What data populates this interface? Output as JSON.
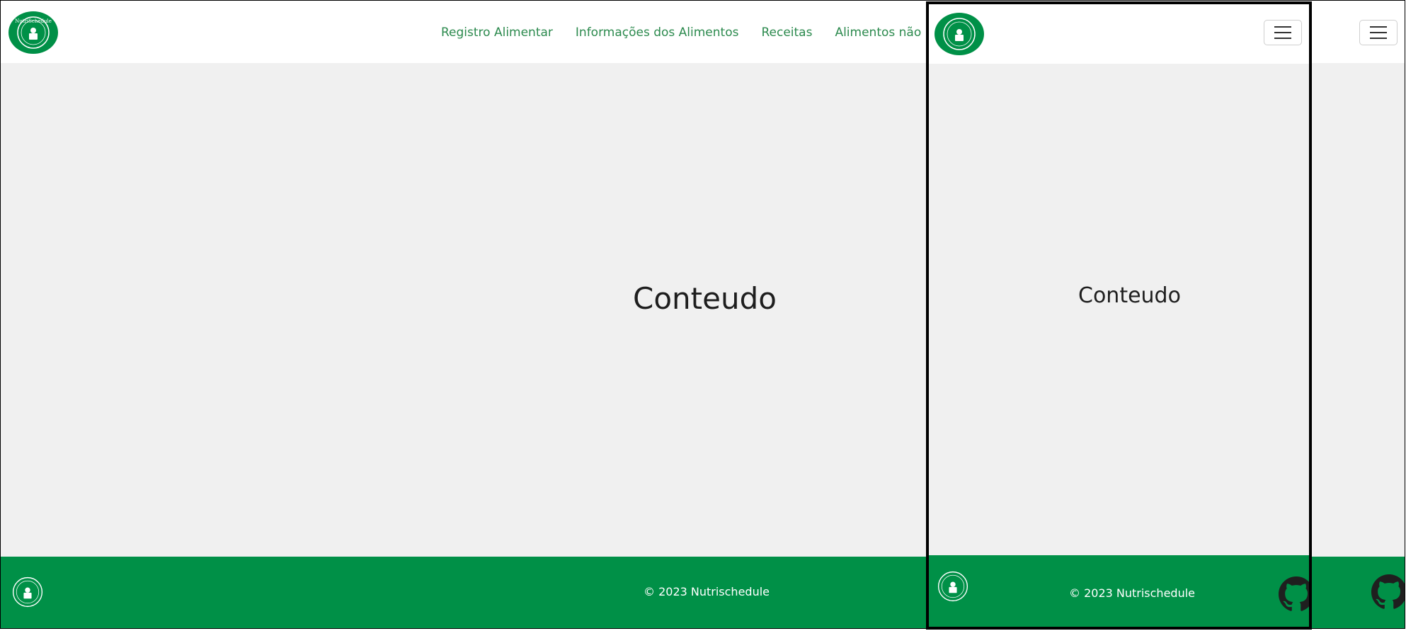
{
  "desktop": {
    "logo_alt": "NutriSchedule",
    "nav": {
      "links": [
        {
          "label": "Registro Alimentar"
        },
        {
          "label": "Informações dos Alimentos"
        },
        {
          "label": "Receitas"
        },
        {
          "label": "Alimentos não reco"
        }
      ]
    },
    "content_title": "Conteudo",
    "footer": {
      "copyright": "© 2023 Nutrischedule"
    }
  },
  "mobile": {
    "content_title": "Conteudo",
    "footer": {
      "copyright": "© 2023 Nutrischedule"
    }
  },
  "icons": {
    "menu": "hamburger-menu-icon",
    "github": "github-icon",
    "logo": "nutrischedule-logo"
  },
  "colors": {
    "brand_green": "#009047",
    "link_green": "#2c8a4e",
    "content_bg": "#f0f0f0"
  }
}
